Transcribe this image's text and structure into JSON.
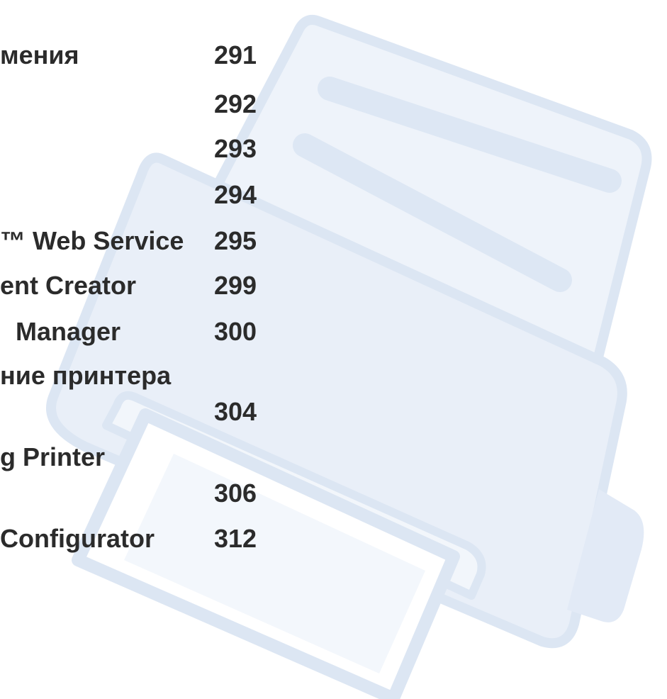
{
  "toc": {
    "items": [
      {
        "title": "мения",
        "page": "291"
      },
      {
        "title": "",
        "page": "292"
      },
      {
        "title": "",
        "page": "293"
      },
      {
        "title": "",
        "page": "294"
      },
      {
        "title": "™ Web Service",
        "page": "295"
      },
      {
        "title": "ent Creator",
        "page": "299"
      },
      {
        "title": "Manager",
        "page": "300"
      },
      {
        "title": "ние принтера",
        "page": ""
      },
      {
        "title": "",
        "page": "304"
      },
      {
        "title": "g Printer",
        "page": ""
      },
      {
        "title": "",
        "page": "306"
      },
      {
        "title": "Configurator",
        "page": "312"
      }
    ]
  },
  "colors": {
    "text": "#2b2b2b",
    "watermark_fill": "#e9eff8",
    "watermark_stroke": "#dce6f3",
    "watermark_bar": "#dde7f4"
  },
  "icons": {
    "background": "printer-watermark-icon"
  }
}
